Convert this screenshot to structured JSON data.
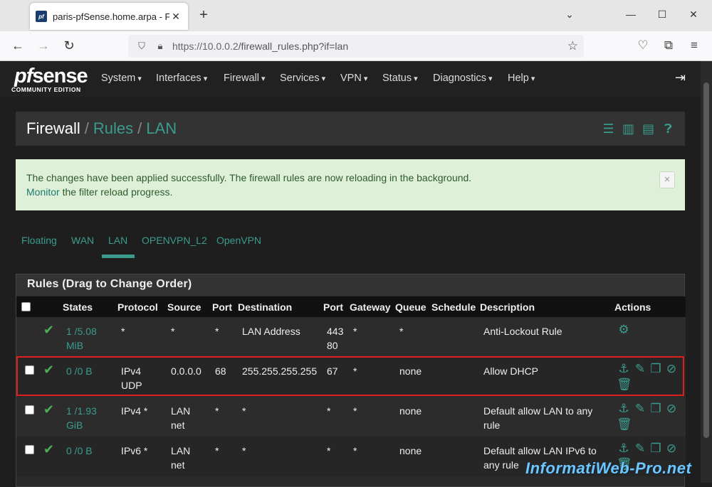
{
  "browser": {
    "tab_title": "paris-pfSense.home.arpa - Firew",
    "favicon_text": "pf",
    "url_host": "https://10.0.0.2",
    "url_path": "/firewall_rules.php?if=lan"
  },
  "brand": {
    "logo_pf": "pf",
    "logo_sense": "sense",
    "edition": "COMMUNITY EDITION",
    "accent": "#3b9c8e"
  },
  "nav": [
    "System",
    "Interfaces",
    "Firewall",
    "Services",
    "VPN",
    "Status",
    "Diagnostics",
    "Help"
  ],
  "breadcrumb": {
    "root": "Firewall",
    "sep": "/",
    "mid": "Rules",
    "current": "LAN"
  },
  "alert": {
    "message": "The changes have been applied successfully. The firewall rules are now reloading in the background.",
    "link": "Monitor",
    "suffix": " the filter reload progress.",
    "close": "×"
  },
  "iface_tabs": [
    "Floating",
    "WAN",
    "LAN",
    "OPENVPN_L2",
    "OpenVPN"
  ],
  "panel_title": "Rules (Drag to Change Order)",
  "columns": [
    "States",
    "Protocol",
    "Source",
    "Port",
    "Destination",
    "Port",
    "Gateway",
    "Queue",
    "Schedule",
    "Description",
    "Actions"
  ],
  "rules": [
    {
      "states1": "1 /5.08",
      "states2": "MiB",
      "proto1": "*",
      "proto2": "",
      "src1": "*",
      "src2": "",
      "sport": "*",
      "dest": "LAN Address",
      "dport1": "443",
      "dport2": "80",
      "gw": "*",
      "queue": "*",
      "sched": "",
      "desc1": "Anti-Lockout Rule",
      "desc2": ""
    },
    {
      "states1": "0 /0 B",
      "states2": "",
      "proto1": "IPv4",
      "proto2": "UDP",
      "src1": "0.0.0.0",
      "src2": "",
      "sport": "68",
      "dest": "255.255.255.255",
      "dport1": "67",
      "dport2": "",
      "gw": "*",
      "queue": "none",
      "sched": "",
      "desc1": "Allow DHCP",
      "desc2": ""
    },
    {
      "states1": "1 /1.93",
      "states2": "GiB",
      "proto1": "IPv4 *",
      "proto2": "",
      "src1": "LAN",
      "src2": "net",
      "sport": "*",
      "dest": "*",
      "dport1": "*",
      "dport2": "",
      "gw": "*",
      "queue": "none",
      "sched": "",
      "desc1": "Default allow LAN to any",
      "desc2": "rule"
    },
    {
      "states1": "0 /0 B",
      "states2": "",
      "proto1": "IPv6 *",
      "proto2": "",
      "src1": "LAN",
      "src2": "net",
      "sport": "*",
      "dest": "*",
      "dport1": "*",
      "dport2": "",
      "gw": "*",
      "queue": "none",
      "sched": "",
      "desc1": "Default allow LAN IPv6 to",
      "desc2": "any rule"
    }
  ],
  "watermark": "InformatiWeb-Pro.net"
}
